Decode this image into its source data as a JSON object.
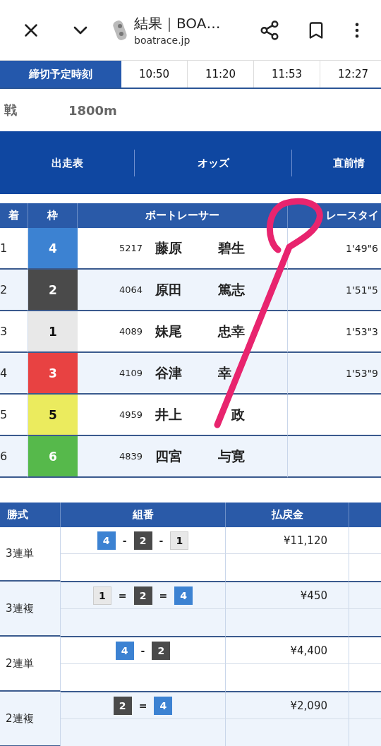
{
  "toolbar": {
    "title": "結果｜BOA…",
    "url": "boatrace.jp"
  },
  "deadline": {
    "label": "締切予定時刻",
    "times": [
      "10:50",
      "11:20",
      "11:53",
      "12:27"
    ]
  },
  "race": {
    "name": "戦",
    "distance": "1800m"
  },
  "nav": [
    "出走表",
    "オッズ",
    "直前情"
  ],
  "results": {
    "columns": [
      "着",
      "枠",
      "ボートレーサー",
      "レースタイ"
    ],
    "rows": [
      {
        "place": "1",
        "frame": "4",
        "color": "#3c82d2",
        "id": "5217",
        "surname": "藤原",
        "given": "碧生",
        "time": "1'49\"6"
      },
      {
        "place": "2",
        "frame": "2",
        "color": "#4a4a4a",
        "id": "4064",
        "surname": "原田",
        "given": "篤志",
        "time": "1'51\"5"
      },
      {
        "place": "3",
        "frame": "1",
        "color": "#e8e8e8",
        "id": "4089",
        "surname": "妹尾",
        "given": "忠幸",
        "time": "1'53\"3"
      },
      {
        "place": "4",
        "frame": "3",
        "color": "#e84242",
        "id": "4109",
        "surname": "谷津",
        "given": "幸",
        "time": "1'53\"9"
      },
      {
        "place": "5",
        "frame": "5",
        "color": "#ebeb5e",
        "id": "4959",
        "surname": "井上",
        "given": "　政"
      },
      {
        "place": "6",
        "frame": "6",
        "color": "#56b94b",
        "id": "4839",
        "surname": "四宮",
        "given": "与寛"
      }
    ]
  },
  "payouts": {
    "columns": [
      "勝式",
      "組番",
      "払戻金"
    ],
    "rows": [
      {
        "type": "3連単",
        "amount": "¥11,120",
        "combo": [
          {
            "kind": "boat",
            "num": "4",
            "color": "#3c82d2"
          },
          {
            "kind": "sep",
            "text": "-"
          },
          {
            "kind": "boat",
            "num": "2",
            "color": "#4a4a4a"
          },
          {
            "kind": "sep",
            "text": "-"
          },
          {
            "kind": "boat",
            "num": "1",
            "color": "#e8e8e8"
          }
        ]
      },
      {
        "type": "3連複",
        "amount": "¥450",
        "combo": [
          {
            "kind": "boat",
            "num": "1",
            "color": "#e8e8e8"
          },
          {
            "kind": "sep",
            "text": "="
          },
          {
            "kind": "boat",
            "num": "2",
            "color": "#4a4a4a"
          },
          {
            "kind": "sep",
            "text": "="
          },
          {
            "kind": "boat",
            "num": "4",
            "color": "#3c82d2"
          }
        ]
      },
      {
        "type": "2連単",
        "amount": "¥4,400",
        "combo": [
          {
            "kind": "boat",
            "num": "4",
            "color": "#3c82d2"
          },
          {
            "kind": "sep",
            "text": "-"
          },
          {
            "kind": "boat",
            "num": "2",
            "color": "#4a4a4a"
          }
        ]
      },
      {
        "type": "2連複",
        "amount": "¥2,090",
        "combo": [
          {
            "kind": "boat",
            "num": "2",
            "color": "#4a4a4a"
          },
          {
            "kind": "sep",
            "text": "="
          },
          {
            "kind": "boat",
            "num": "4",
            "color": "#3c82d2"
          }
        ]
      }
    ]
  }
}
